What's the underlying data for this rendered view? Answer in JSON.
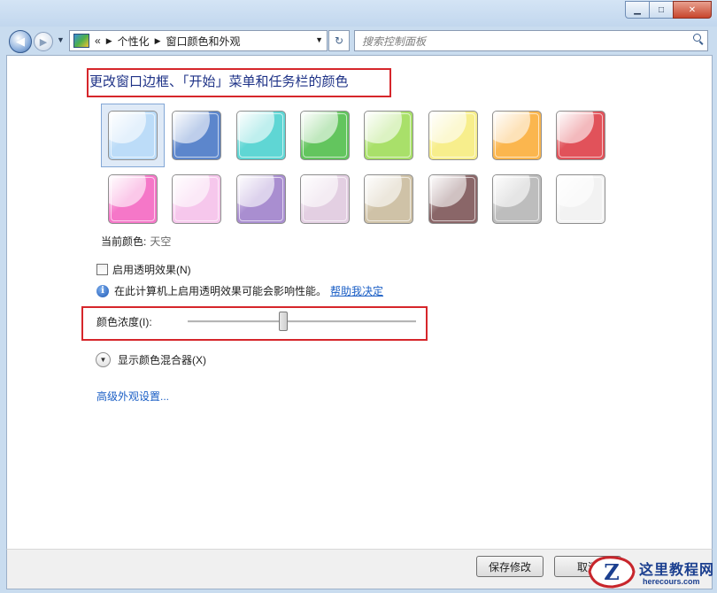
{
  "window": {
    "minimize_label": "▁",
    "maximize_label": "□",
    "close_label": "✕"
  },
  "address_bar": {
    "chevron": "«",
    "breadcrumb": [
      "个性化",
      "窗口颜色和外观"
    ]
  },
  "search": {
    "placeholder": "搜索控制面板"
  },
  "heading": "更改窗口边框、「开始」菜单和任务栏的颜色",
  "swatches": [
    {
      "name": "sky",
      "color": "#bcdcf8",
      "selected": true
    },
    {
      "name": "twilight",
      "color": "#5c86cc"
    },
    {
      "name": "sea",
      "color": "#5fd6d4"
    },
    {
      "name": "leaf",
      "color": "#63c55e"
    },
    {
      "name": "lime",
      "color": "#a9e06a"
    },
    {
      "name": "lightning",
      "color": "#f7ee8c"
    },
    {
      "name": "pumpkin",
      "color": "#fbb64e"
    },
    {
      "name": "blush",
      "color": "#e1525a"
    },
    {
      "name": "bubblegum",
      "color": "#f577c8"
    },
    {
      "name": "blossom",
      "color": "#f6c7ec"
    },
    {
      "name": "dusk",
      "color": "#a98ed0"
    },
    {
      "name": "lavender",
      "color": "#e3cfe2"
    },
    {
      "name": "taupe",
      "color": "#cfc2a7"
    },
    {
      "name": "chocolate",
      "color": "#8a6668"
    },
    {
      "name": "slate",
      "color": "#bdbdbd"
    },
    {
      "name": "frost",
      "color": "#f2f2f2"
    }
  ],
  "current_color": {
    "label": "当前颜色:",
    "value": "天空"
  },
  "transparency": {
    "label": "启用透明效果(N)",
    "checked": false
  },
  "info": {
    "text": "在此计算机上启用透明效果可能会影响性能。",
    "link": "帮助我决定"
  },
  "intensity": {
    "label": "颜色浓度(I):",
    "value_fraction": 0.42
  },
  "mixer": {
    "label": "显示颜色混合器(X)"
  },
  "advanced_link": "高级外观设置...",
  "buttons": {
    "save": "保存修改",
    "cancel": "取消"
  },
  "watermark": {
    "title": "这里教程网",
    "url": "herecours.com",
    "logo": "Z"
  },
  "colors": {
    "accent_red": "#d6262b",
    "link_blue": "#1a5ec5",
    "heading_blue": "#1e3287"
  }
}
